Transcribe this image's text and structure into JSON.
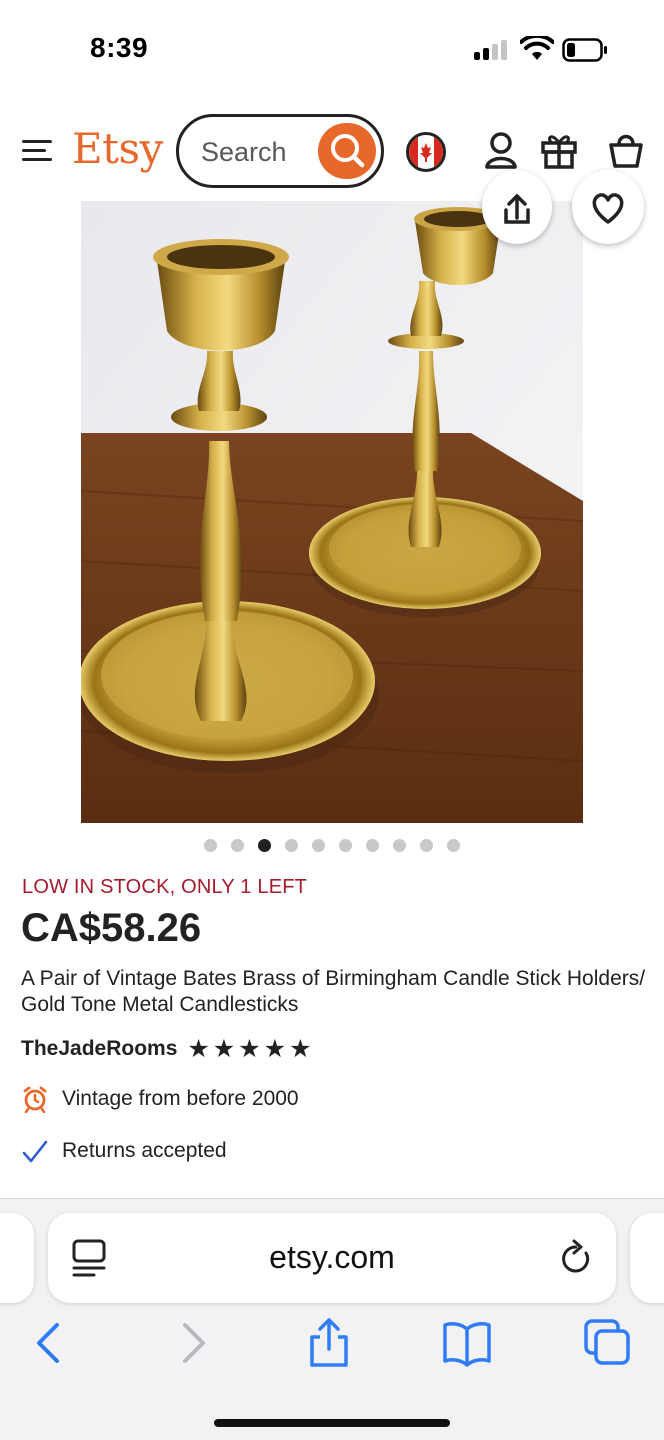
{
  "status_bar": {
    "time": "8:39",
    "icons": [
      "cellular-signal-icon",
      "wifi-icon",
      "battery-icon"
    ]
  },
  "header": {
    "logo": "Etsy",
    "search_placeholder": "Search",
    "icons": [
      "menu-icon",
      "search-icon",
      "canada-flag-icon",
      "user-icon",
      "gift-icon",
      "cart-icon"
    ],
    "brand_color": "#e6692b"
  },
  "gallery": {
    "image_alt": "brass candlesticks photo",
    "total_images": 10,
    "active_index": 2,
    "icons": [
      "share-icon",
      "heart-icon"
    ]
  },
  "product": {
    "stock_notice": "LOW IN STOCK, ONLY 1 LEFT",
    "price": "CA$58.26",
    "title": "A Pair of Vintage Bates Brass of Birmingham Candle Stick Holders/ Gold Tone Metal Candlesticks",
    "shop_name": "TheJadeRooms",
    "rating": 5,
    "rating_max": 5,
    "features": [
      {
        "icon": "alarm-clock-icon",
        "text": "Vintage from before 2000"
      },
      {
        "icon": "checkmark-icon",
        "text": "Returns accepted"
      }
    ],
    "stock_color": "#a61a2e"
  },
  "browser": {
    "url": "etsy.com",
    "icons": [
      "reader-icon",
      "reload-icon",
      "back-icon",
      "forward-icon",
      "share-icon",
      "bookmarks-icon",
      "tabs-icon"
    ],
    "accent_color": "#2f7cf6"
  }
}
